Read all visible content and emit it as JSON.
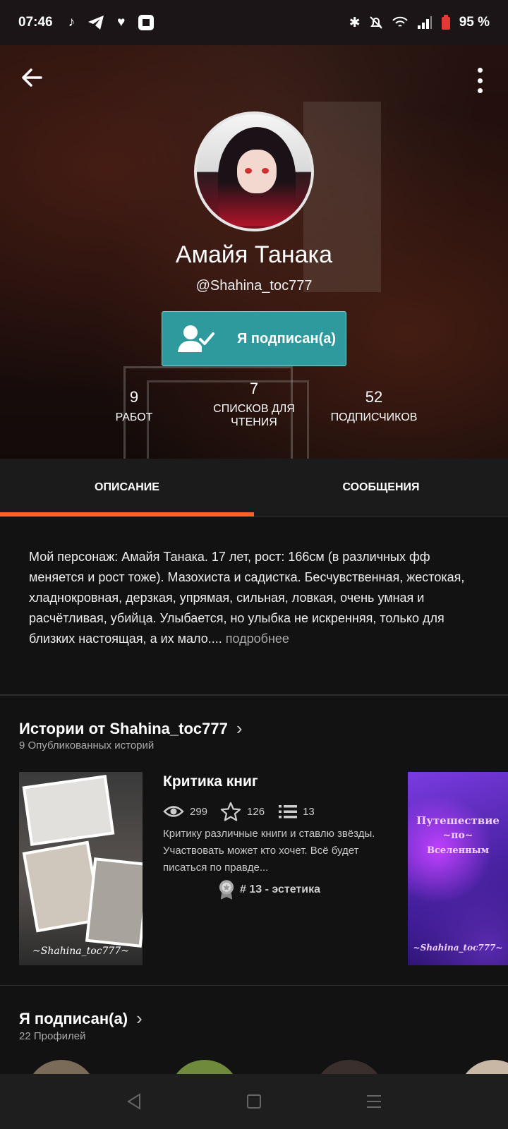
{
  "status_bar": {
    "time": "07:46",
    "battery": "95 %"
  },
  "profile": {
    "name": "Амайя Танака",
    "handle": "@Shahina_toc777",
    "follow_label": "Я подписан(а)"
  },
  "stats": [
    {
      "value": "9",
      "label": "РАБОТ"
    },
    {
      "value": "7",
      "label": "СПИСКОВ ДЛЯ ЧТЕНИЯ"
    },
    {
      "value": "52",
      "label": "ПОДПИСЧИКОВ"
    }
  ],
  "tabs": [
    {
      "label": "ОПИСАНИЕ",
      "active": true
    },
    {
      "label": "СООБЩЕНИЯ",
      "active": false
    }
  ],
  "description": {
    "text": "Мой персонаж: Амайя Танака. 17 лет, рост: 166см (в различных фф меняется и рост тоже). Мазохиста и садистка. Бесчувственная, жестокая, хладнокровная, дерзкая, упрямая, сильная, ловкая, очень умная и расчётливая, убийца. Улыбается, но улыбка не искренняя, только для близких настоящая, а их мало....",
    "more": "подробнее"
  },
  "stories": {
    "title": "Истории от Shahina_toc777",
    "subtitle": "9 Опубликованных историй",
    "items": [
      {
        "title": "Критика книг",
        "views": "299",
        "votes": "126",
        "parts": "13",
        "desc": "Критику различные книги и ставлю звёзды. Участвовать может кто хочет. Всё будет писаться по правде...",
        "tag": "# 13 - эстетика",
        "cover_caption": "~Shahina_toc777~"
      },
      {
        "cover_lines": [
          "Путешествие",
          "~по~",
          "Вселенным",
          "~Shahina_toc777~"
        ]
      }
    ]
  },
  "following": {
    "title": "Я подписан(а)",
    "subtitle": "22 Профилей"
  },
  "colors": {
    "accent": "#ff6122",
    "follow_button": "#2f9a9e",
    "background": "#121212"
  }
}
